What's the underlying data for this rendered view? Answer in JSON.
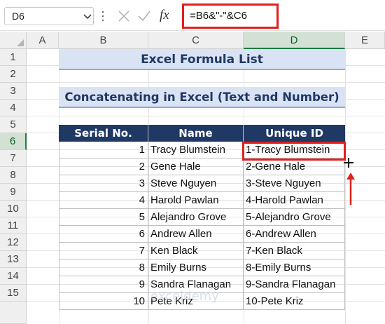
{
  "name_box": {
    "value": "D6"
  },
  "formula_bar": {
    "fx_label": "fx",
    "formula": "=B6&\"-\"&C6"
  },
  "columns": [
    "A",
    "B",
    "C",
    "D",
    "E"
  ],
  "rows": [
    "1",
    "2",
    "3",
    "4",
    "5",
    "6",
    "7",
    "8",
    "9",
    "10",
    "11",
    "12",
    "13",
    "14",
    "15"
  ],
  "title": "Excel Formula List",
  "subtitle": "Concatenating in Excel (Text and Number)",
  "table": {
    "headers": [
      "Serial No.",
      "Name",
      "Unique ID"
    ],
    "rows": [
      {
        "serial": "1",
        "name": "Tracy Blumstein",
        "uid": "1-Tracy Blumstein"
      },
      {
        "serial": "2",
        "name": "Gene Hale",
        "uid": "2-Gene Hale"
      },
      {
        "serial": "3",
        "name": "Steve Nguyen",
        "uid": "3-Steve Nguyen"
      },
      {
        "serial": "4",
        "name": "Harold Pawlan",
        "uid": "4-Harold Pawlan"
      },
      {
        "serial": "5",
        "name": "Alejandro Grove",
        "uid": "5-Alejandro Grove"
      },
      {
        "serial": "6",
        "name": "Andrew Allen",
        "uid": "6-Andrew Allen"
      },
      {
        "serial": "7",
        "name": "Ken Black",
        "uid": "7-Ken Black"
      },
      {
        "serial": "8",
        "name": "Emily Burns",
        "uid": "8-Emily Burns"
      },
      {
        "serial": "9",
        "name": "Sandra Flanagan",
        "uid": "9-Sandra Flanagan"
      },
      {
        "serial": "10",
        "name": "Pete Kriz",
        "uid": "10-Pete Kriz"
      }
    ]
  },
  "watermark": "exceldemy",
  "colors": {
    "accent_red": "#e0201b",
    "header_fill": "#203864",
    "title_fill": "#dae3f3",
    "selection_green": "#1e7b40"
  },
  "icons": [
    "chevron-down-icon",
    "cancel-x-icon",
    "enter-check-icon",
    "fx-icon",
    "fill-handle-plus-icon",
    "up-arrow-icon"
  ]
}
